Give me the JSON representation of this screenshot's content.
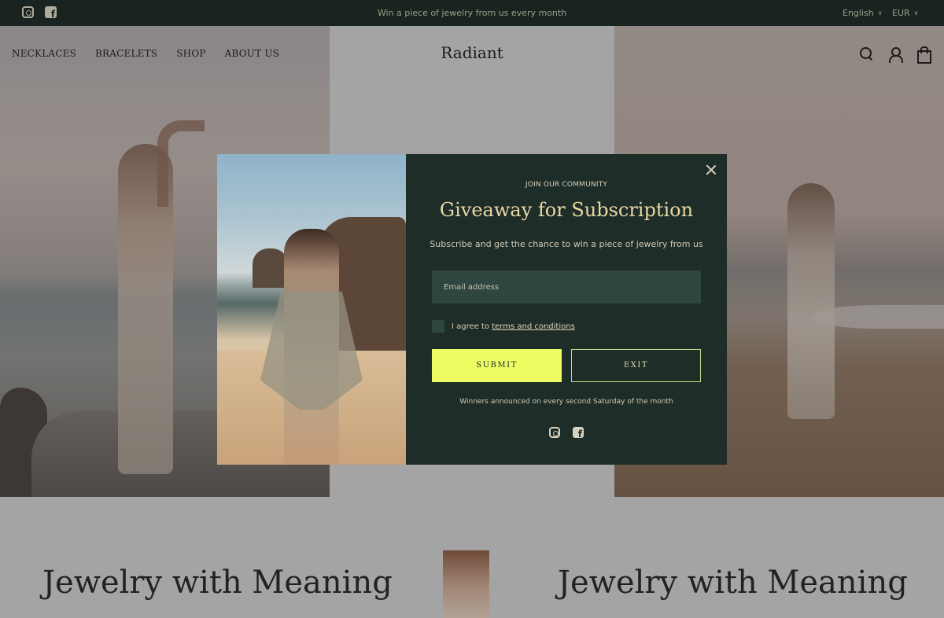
{
  "topbar": {
    "announcement": "Win a piece of jewelry from us every month",
    "language": "English",
    "currency": "EUR",
    "social": [
      "instagram-icon",
      "facebook-icon"
    ]
  },
  "header": {
    "logo": "Radiant",
    "nav": [
      "NECKLACES",
      "BRACELETS",
      "SHOP",
      "ABOUT US"
    ],
    "icons": [
      "search-icon",
      "account-icon",
      "cart-icon"
    ]
  },
  "lower": {
    "heading_left": "Jewelry with Meaning",
    "heading_right": "Jewelry with Meaning"
  },
  "modal": {
    "eyebrow": "JOIN OUR COMMUNITY",
    "title": "Giveaway for Subscription",
    "subtitle": "Subscribe and get the chance to win a piece of jewelry from us",
    "email_placeholder": "Email address",
    "agree_prefix": "I agree to",
    "agree_link": "terms and conditions",
    "submit_label": "SUBMIT",
    "exit_label": "EXIT",
    "footnote": "Winners announced on every second Saturday of the month",
    "social": [
      "instagram-icon",
      "facebook-icon"
    ]
  },
  "colors": {
    "topbar_bg": "#1f2b27",
    "modal_bg": "#1f2d28",
    "title": "#e8d7a5",
    "submit_bg": "#eefc64",
    "input_bg": "#2f4540"
  }
}
